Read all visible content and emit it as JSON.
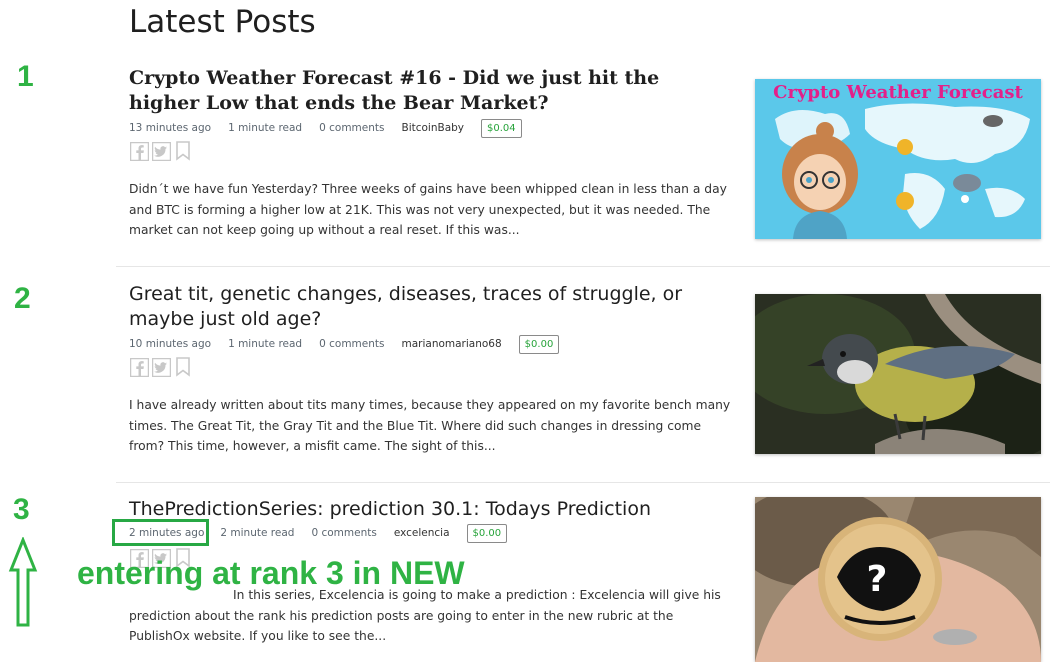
{
  "page": {
    "title": "Latest Posts"
  },
  "ranks": [
    "1",
    "2",
    "3"
  ],
  "colors": {
    "annotation_green": "#2fb344",
    "price_green": "#27a33a"
  },
  "posts": [
    {
      "title": "Crypto Weather Forecast #16 - Did we just hit the higher Low that ends the Bear Market?",
      "time": "13 minutes ago",
      "read": "1 minute read",
      "comments": "0 comments",
      "author": "BitcoinBaby",
      "price": "$0.04",
      "excerpt": "Didn´t we have fun Yesterday? Three weeks of gains have been whipped clean in less than a day and BTC is forming a higher low at 21K. This was not very unexpected, but it was needed. The market can not keep going up without a real reset. If this was...",
      "thumb_caption": "Crypto Weather Forecast"
    },
    {
      "title": "Great tit, genetic changes, diseases, traces of struggle, or maybe just old age?",
      "time": "10 minutes ago",
      "read": "1 minute read",
      "comments": "0 comments",
      "author": "marianomariano68",
      "price": "$0.00",
      "excerpt": "I have already written about tits many times, because they appeared on my favorite bench many times. The Great Tit, the Gray Tit and the Blue Tit. Where did such changes in dressing come from? This time, however, a misfit came. The sight of this..."
    },
    {
      "title": "ThePredictionSeries: prediction 30.1: Todays Prediction",
      "time": "2 minutes ago",
      "read": "2 minute read",
      "comments": "0 comments",
      "author": "excelencia",
      "price": "$0.00",
      "excerpt": "In this  series, Excelencia is going  to make a  prediction : Excelencia will give his prediction about the rank his  prediction posts are going to enter in the new rubric at the PublishOx website. If you like to see the...",
      "thumb_symbol": "?"
    }
  ],
  "annotation": {
    "text": "entering at rank 3 in NEW"
  },
  "icons": [
    "facebook-icon",
    "twitter-icon",
    "bookmark-icon",
    "arrow-up-icon"
  ]
}
